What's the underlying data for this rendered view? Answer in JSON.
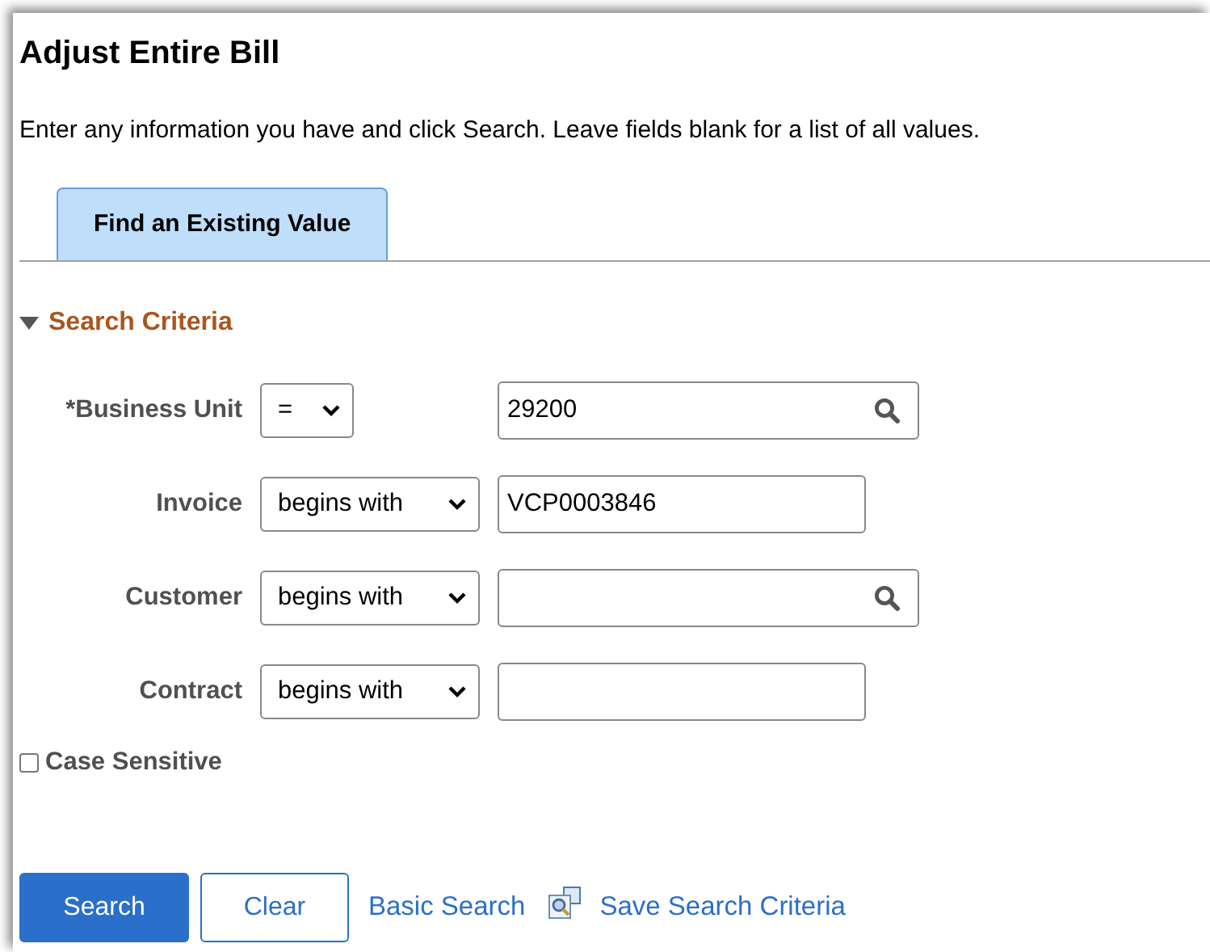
{
  "page": {
    "title": "Adjust Entire Bill",
    "instructions": "Enter any information you have and click Search. Leave fields blank for a list of all values."
  },
  "tabs": [
    {
      "label": "Find an Existing Value",
      "selected": true
    }
  ],
  "search_criteria": {
    "title": "Search Criteria",
    "expanded": true,
    "fields": [
      {
        "label": "*Business Unit",
        "operator": "=",
        "value": "29200",
        "kind": "lookup"
      },
      {
        "label": "Invoice",
        "operator": "begins with",
        "value": "VCP0003846",
        "kind": "text"
      },
      {
        "label": "Customer",
        "operator": "begins with",
        "kind": "lookup"
      },
      {
        "label": "Contract",
        "operator": "begins with",
        "kind": "text"
      }
    ],
    "case_sensitive": {
      "label": "Case Sensitive",
      "checked": false
    }
  },
  "actions": {
    "search": "Search",
    "clear": "Clear",
    "basic_search": "Basic Search",
    "save_search_criteria": "Save Search Criteria"
  }
}
